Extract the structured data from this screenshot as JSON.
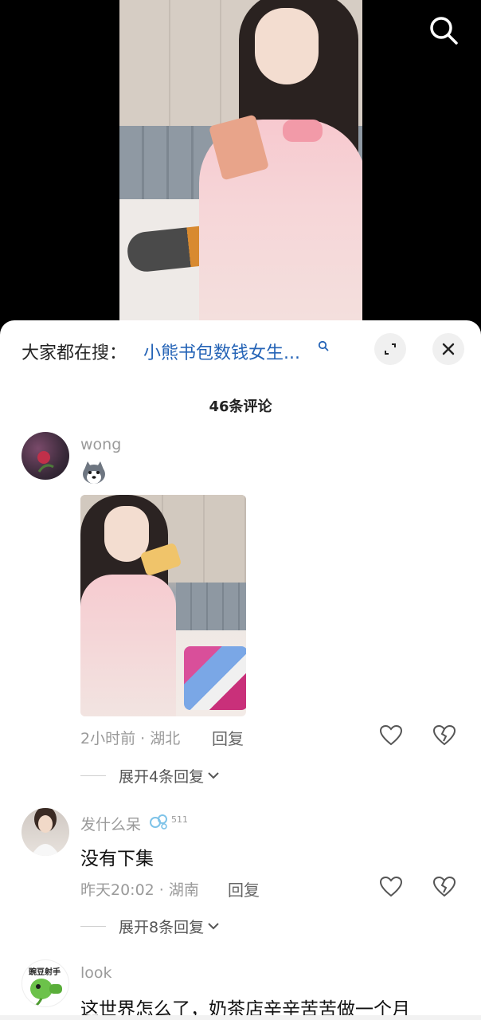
{
  "video": {
    "search_icon": "search-icon"
  },
  "sheet": {
    "trending_prefix": "大家都在搜：",
    "trending_query": "小熊书包数钱女生...",
    "expand_icon": "expand-icon",
    "close_icon": "close-icon",
    "comment_count": "46条评论"
  },
  "comments": [
    {
      "username": "wong",
      "text": "",
      "sticker": "husky-sticker-icon",
      "time": "2小时前 · 湖北",
      "reply_label": "回复",
      "expand_label": "展开4条回复"
    },
    {
      "username": "发什么呆",
      "level": "511",
      "text": "没有下集",
      "time": "昨天20:02 · 湖南",
      "reply_label": "回复",
      "expand_label": "展开8条回复"
    },
    {
      "username": "look",
      "avatar_text": "豌豆射手",
      "text": "这世界怎么了，奶茶店辛辛苦苦做一个月"
    }
  ],
  "colors": {
    "link": "#2463b6",
    "muted": "#9a9a9a",
    "sheet_bg": "#ffffff"
  }
}
